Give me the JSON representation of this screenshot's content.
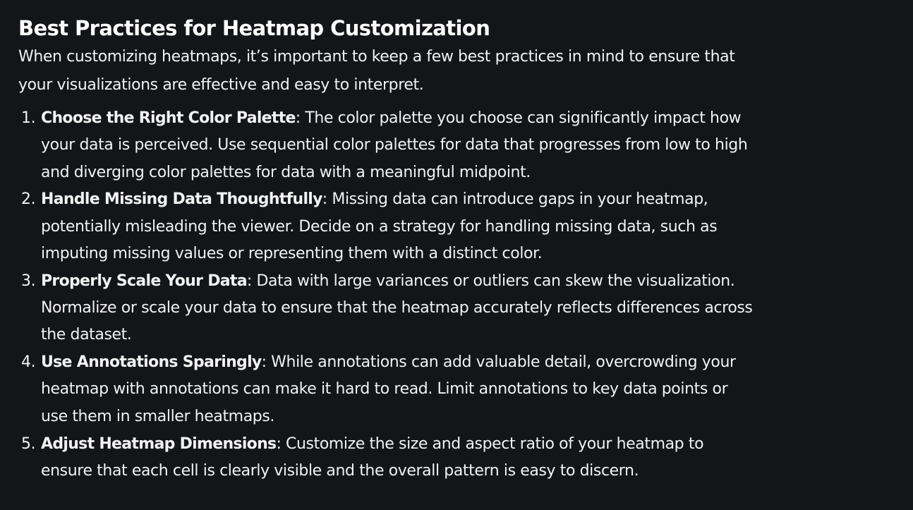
{
  "article": {
    "title": "Best Practices for Heatmap Customization",
    "intro": "When customizing heatmaps, it’s important to keep a few best practices in mind to ensure that your visualizations are effective and easy to interpret.",
    "practices": [
      {
        "number": "1.",
        "term": "Choose the Right Color Palette",
        "text": ": The color palette you choose can significantly impact how your data is perceived. Use sequential color palettes for data that progresses from low to high and diverging color palettes for data with a meaningful midpoint."
      },
      {
        "number": "2.",
        "term": "Handle Missing Data Thoughtfully",
        "text": ": Missing data can introduce gaps in your heatmap, potentially misleading the viewer. Decide on a strategy for handling missing data, such as imputing missing values or representing them with a distinct color."
      },
      {
        "number": "3.",
        "term": "Properly Scale Your Data",
        "text": ": Data with large variances or outliers can skew the visualization. Normalize or scale your data to ensure that the heatmap accurately reflects differences across the dataset."
      },
      {
        "number": "4.",
        "term": "Use Annotations Sparingly",
        "text": ": While annotations can add valuable detail, overcrowding your heatmap with annotations can make it hard to read. Limit annotations to key data points or use them in smaller heatmaps."
      },
      {
        "number": "5.",
        "term": "Adjust Heatmap Dimensions",
        "text": ": Customize the size and aspect ratio of your heatmap to ensure that each cell is clearly visible and the overall pattern is easy to discern."
      }
    ]
  },
  "colors": {
    "background": "#141519",
    "text": "#f2f2f2"
  }
}
